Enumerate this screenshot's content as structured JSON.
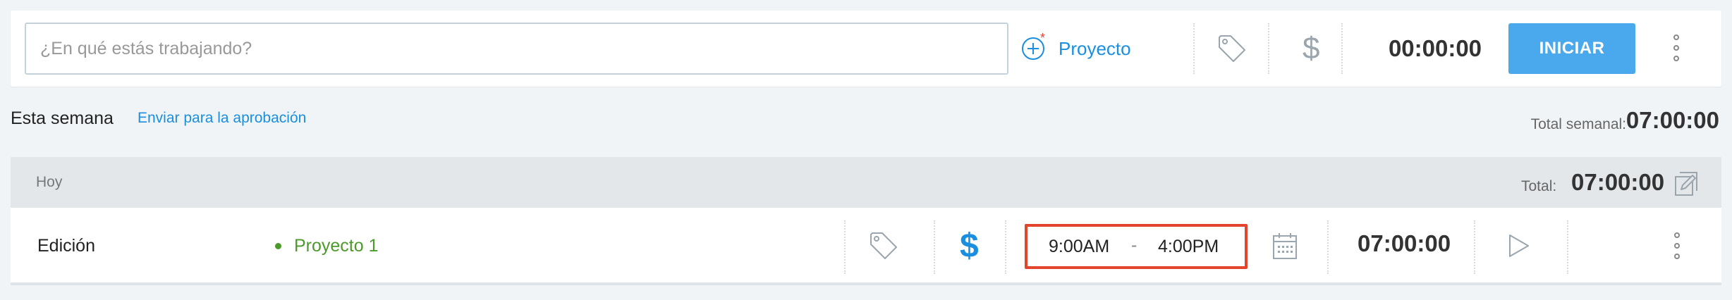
{
  "tracker": {
    "description_placeholder": "¿En qué estás trabajando?",
    "description_value": "",
    "project_label": "Proyecto",
    "timer": "00:00:00",
    "start_label": "INICIAR"
  },
  "week": {
    "title": "Esta semana",
    "approval_link": "Enviar para la aprobación",
    "total_label": "Total semanal:",
    "total_value": "07:00:00"
  },
  "day": {
    "label": "Hoy",
    "total_label": "Total:",
    "total_value": "07:00:00"
  },
  "entry": {
    "description": "Edición",
    "project": "Proyecto 1",
    "start_time": "9:00AM",
    "separator": "-",
    "end_time": "4:00PM",
    "duration": "07:00:00"
  },
  "colors": {
    "accent": "#4aa8ec",
    "link": "#1a8fe0",
    "project_green": "#4c9a2a",
    "highlight_red": "#e2452b",
    "billable_blue": "#1a8fe0"
  },
  "icons": [
    "add-project-icon",
    "tag-icon",
    "billable-dollar-icon",
    "more-options-icon",
    "edit-entries-icon",
    "calendar-icon",
    "play-icon"
  ]
}
